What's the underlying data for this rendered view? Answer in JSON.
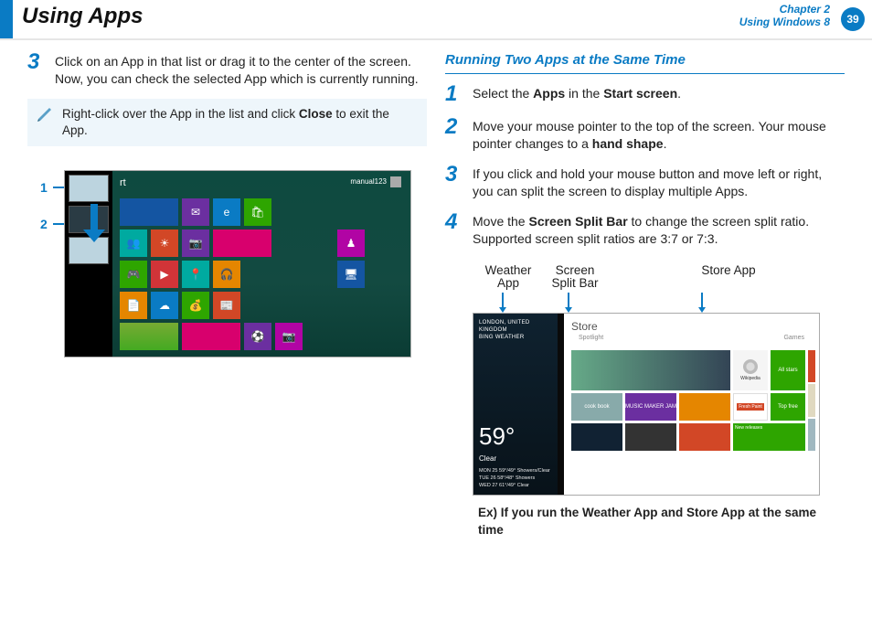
{
  "header": {
    "title": "Using Apps",
    "chapter_label": "Chapter 2",
    "chapter_sub": "Using Windows 8",
    "page_number": "39"
  },
  "left_col": {
    "step3": {
      "num": "3",
      "text_before": "Click on an App in that list or drag it to the center of the screen. Now, you can check the selected App which is currently running."
    },
    "note": {
      "text_a": "Right-click over the App in the list and click ",
      "bold": "Close",
      "text_b": " to exit the App."
    },
    "callouts": {
      "one": "1",
      "two": "2"
    },
    "start_screen": {
      "label": "rt",
      "user": "manual123"
    }
  },
  "right_col": {
    "heading": "Running Two Apps at the Same Time",
    "step1": {
      "num": "1",
      "a": "Select the ",
      "b1": "Apps",
      "c": " in the ",
      "b2": "Start screen",
      "d": "."
    },
    "step2": {
      "num": "2",
      "a": "Move your mouse pointer to the top of the screen. Your mouse pointer changes to a ",
      "b": "hand shape",
      "c": "."
    },
    "step3": {
      "num": "3",
      "a": "If you click and hold your mouse button and move left or right, you can split the screen to display multiple Apps."
    },
    "step4": {
      "num": "4",
      "a": "Move the ",
      "b": "Screen Split Bar",
      "c": " to change the screen split ratio. Supported screen split ratios are 3:7 or 7:3."
    },
    "fig_labels": {
      "weather": "Weather App",
      "splitbar": "Screen Split Bar",
      "store": "Store App"
    },
    "weather": {
      "location": "LONDON, UNITED KINGDOM",
      "service": "BING WEATHER",
      "temp": "59°",
      "cond": "Clear",
      "fc1": "MON 25   59°/49°   Showers/Clear",
      "fc2": "TUE 26   58°/48°   Showers",
      "fc3": "WED 27   61°/49°   Clear"
    },
    "store": {
      "title": "Store",
      "section_a": "Spotlight",
      "section_b": "Games",
      "wiki": "Wikipedia",
      "allstars": "All stars",
      "fresh": "Fresh Paint",
      "topfree": "Top free",
      "new": "New releases",
      "book": "cook book",
      "music": "MUSIC MAKER JAM"
    },
    "example_caption": "Ex) If you run the Weather App and Store App at the same time"
  }
}
